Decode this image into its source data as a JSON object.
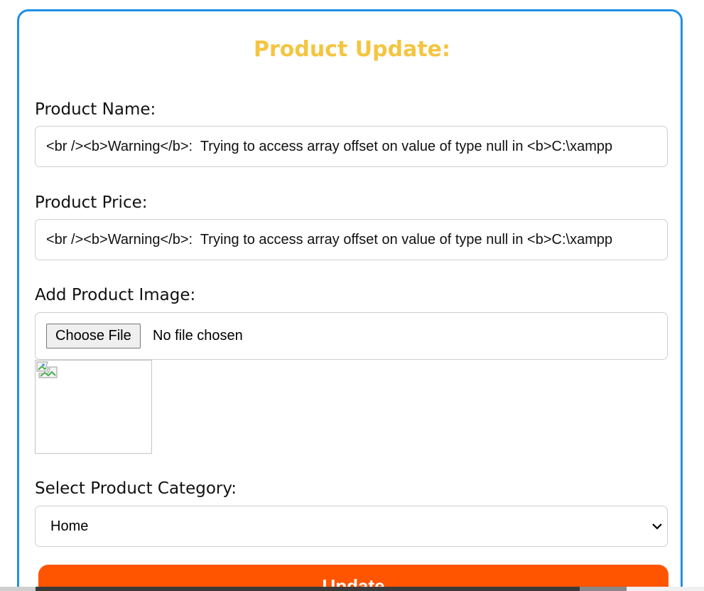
{
  "page": {
    "title": "Product Update:"
  },
  "form": {
    "name_label": "Product Name:",
    "name_value": "<br /><b>Warning</b>:  Trying to access array offset on value of type null in <b>C:\\xampp",
    "price_label": "Product Price:",
    "price_value": "<br /><b>Warning</b>:  Trying to access array offset on value of type null in <b>C:\\xampp",
    "image_label": "Add Product Image:",
    "file_button": "Choose File",
    "file_status": "No file chosen",
    "category_label": "Select Product Category:",
    "category_selected": "Home",
    "submit_label": "Update"
  },
  "icons": {
    "broken_image": "broken-image-icon",
    "select_arrow": "chevron-down-icon"
  },
  "colors": {
    "card_border": "#1e90e8",
    "title": "#f5c542",
    "submit_bg": "#ff5500",
    "submit_text": "#ffffff"
  }
}
